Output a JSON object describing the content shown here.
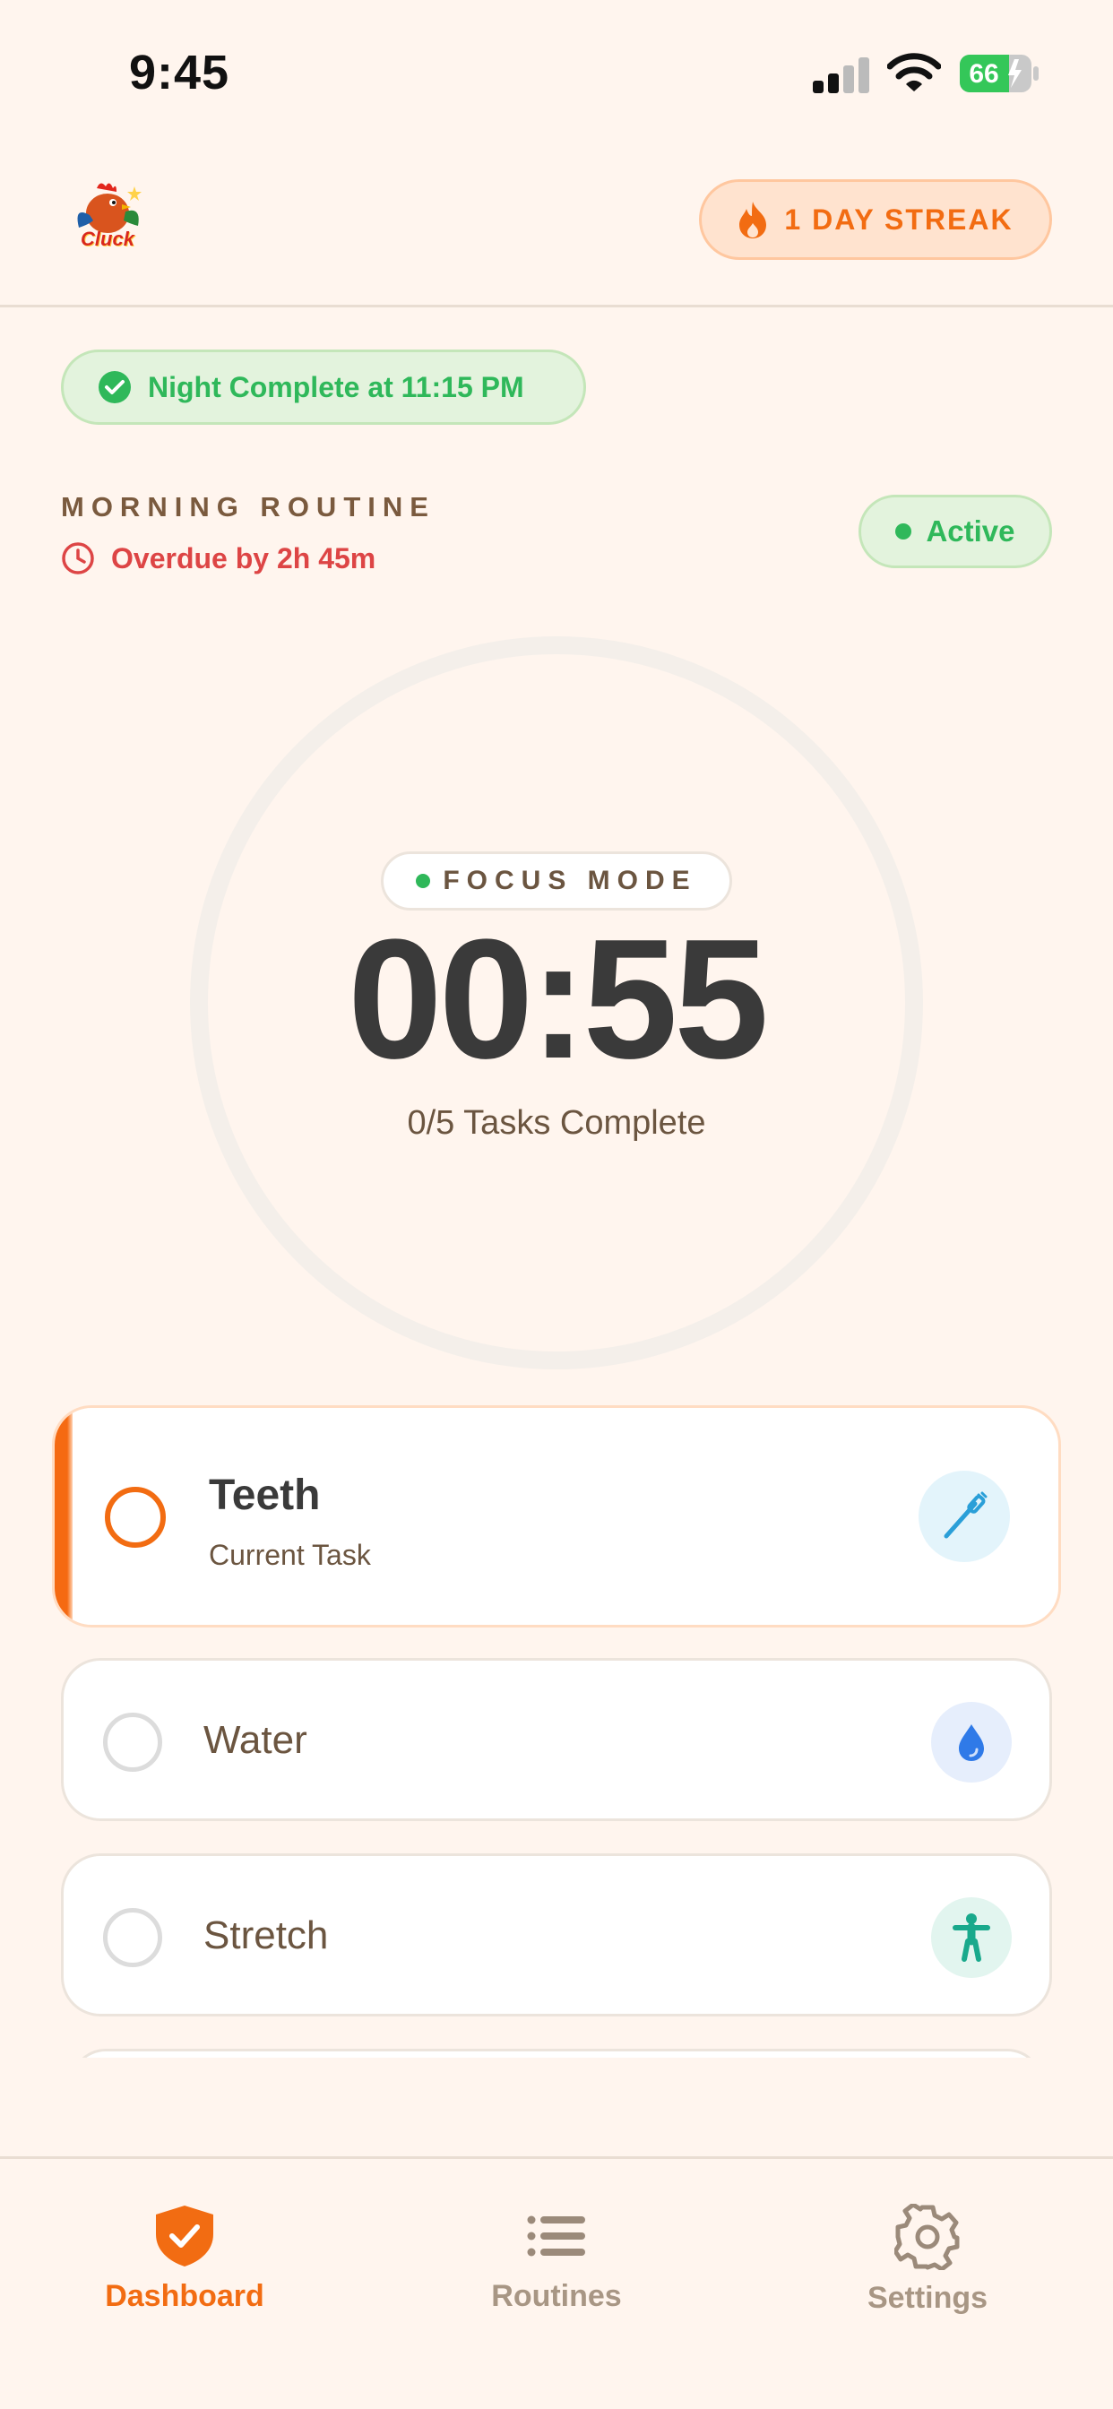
{
  "status_bar": {
    "time": "9:45",
    "battery": "66"
  },
  "header": {
    "logo_text": "Cluck",
    "streak_label": "1 DAY STREAK"
  },
  "night_status": {
    "label": "Night Complete at 11:15 PM"
  },
  "routine": {
    "title": "MORNING ROUTINE",
    "overdue": "Overdue by 2h 45m",
    "status": "Active"
  },
  "timer": {
    "mode": "FOCUS MODE",
    "time": "00:55",
    "progress": "0/5 Tasks Complete"
  },
  "tasks": [
    {
      "name": "Teeth",
      "subtitle": "Current Task",
      "icon": "toothbrush-icon",
      "icon_color": "#2a9fd8"
    },
    {
      "name": "Water",
      "icon": "water-drop-icon",
      "icon_color": "#2f7ae8"
    },
    {
      "name": "Stretch",
      "icon": "stretch-figure-icon",
      "icon_color": "#19a98c"
    }
  ],
  "nav": {
    "items": [
      {
        "label": "Dashboard",
        "icon": "shield-check-icon",
        "active": true
      },
      {
        "label": "Routines",
        "icon": "list-icon",
        "active": false
      },
      {
        "label": "Settings",
        "icon": "gear-icon",
        "active": false
      }
    ]
  },
  "colors": {
    "accent": "#f26c12",
    "success": "#2fb85a",
    "danger": "#dd4545",
    "background": "#fff5ee",
    "brown_text": "#6b5540"
  }
}
